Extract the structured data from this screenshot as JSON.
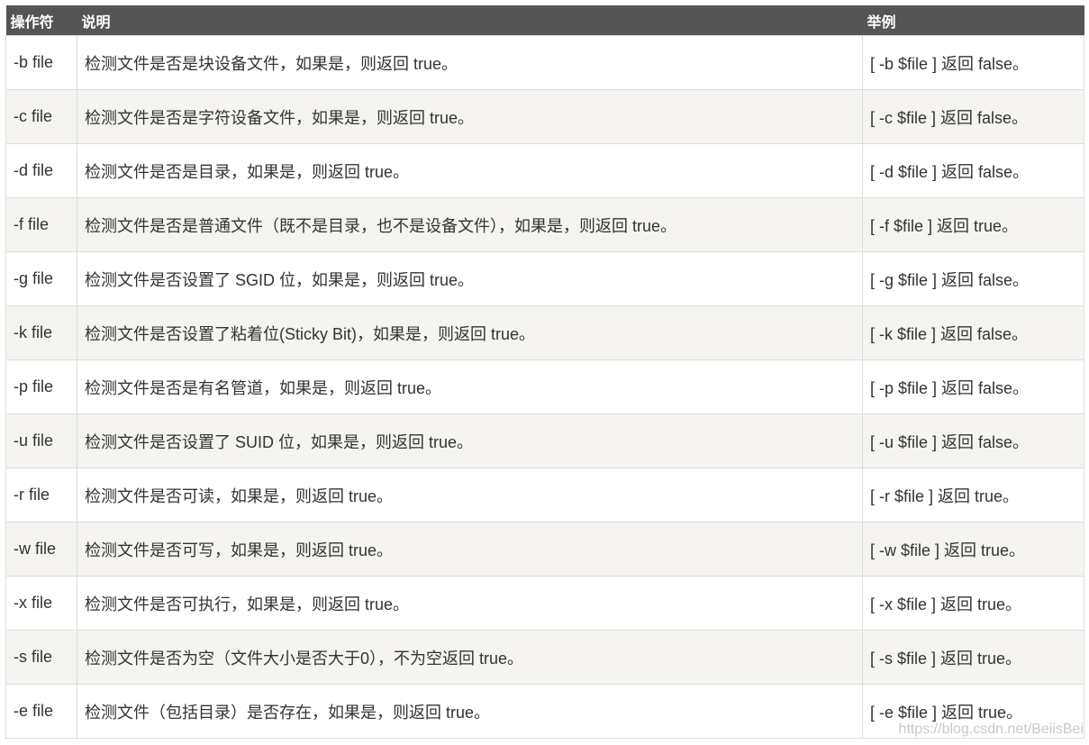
{
  "table": {
    "headers": [
      "操作符",
      "说明",
      "举例"
    ],
    "rows": [
      {
        "op": "-b file",
        "desc": "检测文件是否是块设备文件，如果是，则返回 true。",
        "example": "[ -b $file ] 返回 false。"
      },
      {
        "op": "-c file",
        "desc": "检测文件是否是字符设备文件，如果是，则返回 true。",
        "example": "[ -c $file ] 返回 false。"
      },
      {
        "op": "-d file",
        "desc": "检测文件是否是目录，如果是，则返回 true。",
        "example": "[ -d $file ] 返回 false。"
      },
      {
        "op": "-f file",
        "desc": "检测文件是否是普通文件（既不是目录，也不是设备文件），如果是，则返回 true。",
        "example": "[ -f $file ] 返回 true。"
      },
      {
        "op": "-g file",
        "desc": "检测文件是否设置了 SGID 位，如果是，则返回 true。",
        "example": "[ -g $file ] 返回 false。"
      },
      {
        "op": "-k file",
        "desc": "检测文件是否设置了粘着位(Sticky Bit)，如果是，则返回 true。",
        "example": "[ -k $file ] 返回 false。"
      },
      {
        "op": "-p file",
        "desc": "检测文件是否是有名管道，如果是，则返回 true。",
        "example": "[ -p $file ] 返回 false。"
      },
      {
        "op": "-u file",
        "desc": "检测文件是否设置了 SUID 位，如果是，则返回 true。",
        "example": "[ -u $file ] 返回 false。"
      },
      {
        "op": "-r file",
        "desc": "检测文件是否可读，如果是，则返回 true。",
        "example": "[ -r $file ] 返回 true。"
      },
      {
        "op": "-w file",
        "desc": "检测文件是否可写，如果是，则返回 true。",
        "example": "[ -w $file ] 返回 true。"
      },
      {
        "op": "-x file",
        "desc": "检测文件是否可执行，如果是，则返回 true。",
        "example": "[ -x $file ] 返回 true。"
      },
      {
        "op": "-s file",
        "desc": "检测文件是否为空（文件大小是否大于0），不为空返回 true。",
        "example": "[ -s $file ] 返回 true。"
      },
      {
        "op": "-e file",
        "desc": "检测文件（包括目录）是否存在，如果是，则返回 true。",
        "example": "[ -e $file ] 返回 true。"
      }
    ]
  },
  "watermark": "https://blog.csdn.net/BeiisBei",
  "colors": {
    "header_bg": "#555555",
    "header_text": "#ffffff",
    "row_even_bg": "#f5f4f0",
    "row_odd_bg": "#ffffff",
    "border": "#dddddd",
    "text": "#333333"
  }
}
